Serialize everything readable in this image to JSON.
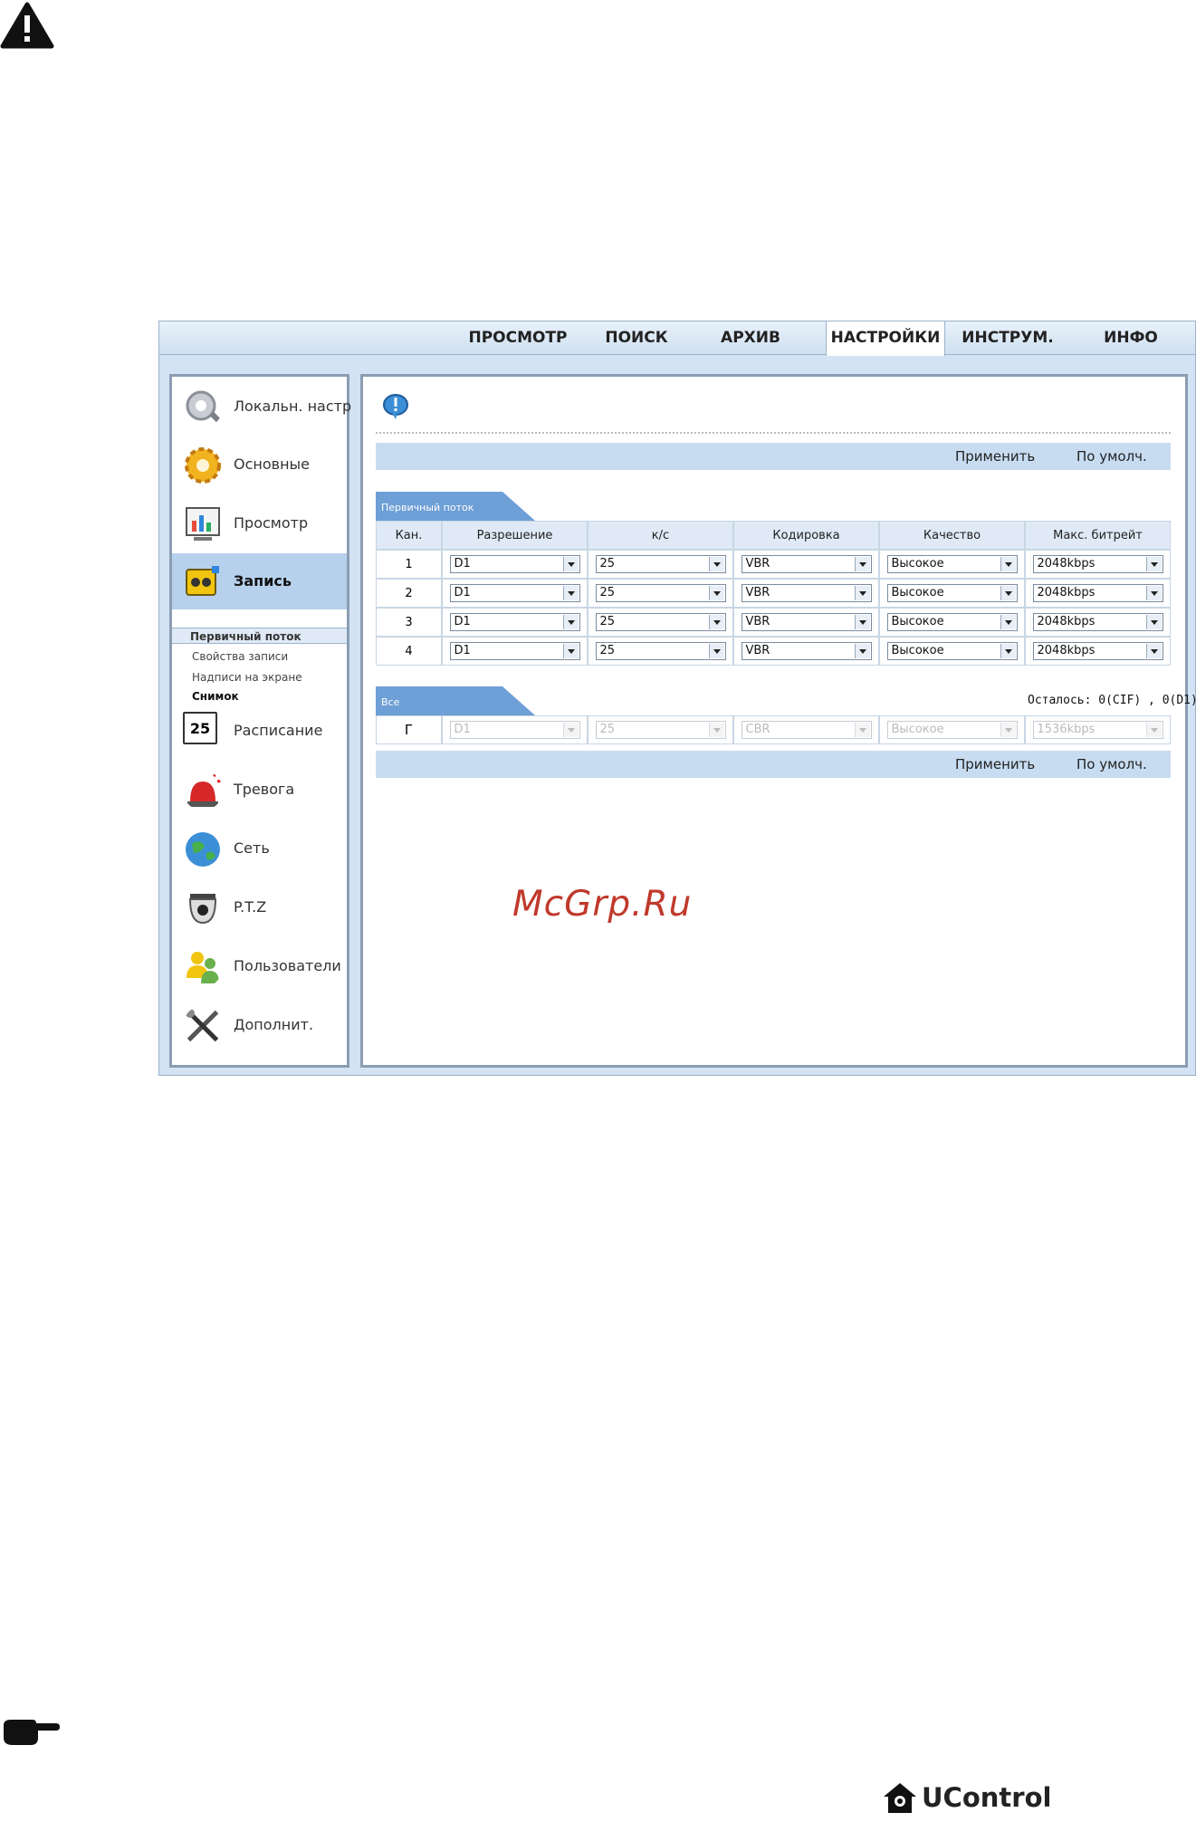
{
  "tabs": [
    "ПРОСМОТР",
    "ПОИСК",
    "АРХИВ",
    "НАСТРОЙКИ",
    "ИНСТРУМ.",
    "ИНФО"
  ],
  "active_tab": "НАСТРОЙКИ",
  "sidebar": {
    "items": [
      "Локальн. настр",
      "Основные",
      "Просмотр",
      "Запись",
      "Расписание",
      "Тревога",
      "Сеть",
      "P.T.Z",
      "Пользователи",
      "Дополнит."
    ],
    "active_item": "Запись",
    "calendar_day": "25",
    "sub_items": [
      "Первичный поток",
      "Свойства записи",
      "Надписи на экране",
      "Снимок"
    ]
  },
  "toolbar": {
    "apply": "Применить",
    "default": "По умолч."
  },
  "primary_stream": {
    "title": "Первичный поток",
    "headers": [
      "Кан.",
      "Разрешение",
      "к/с",
      "Кодировка",
      "Качество",
      "Макс. битрейт"
    ],
    "rows": [
      {
        "ch": "1",
        "res": "D1",
        "fps": "25",
        "enc": "VBR",
        "quality": "Высокое",
        "bitrate": "2048kbps"
      },
      {
        "ch": "2",
        "res": "D1",
        "fps": "25",
        "enc": "VBR",
        "quality": "Высокое",
        "bitrate": "2048kbps"
      },
      {
        "ch": "3",
        "res": "D1",
        "fps": "25",
        "enc": "VBR",
        "quality": "Высокое",
        "bitrate": "2048kbps"
      },
      {
        "ch": "4",
        "res": "D1",
        "fps": "25",
        "enc": "VBR",
        "quality": "Высокое",
        "bitrate": "2048kbps"
      }
    ]
  },
  "all_section": {
    "title": "Все",
    "remaining": "Осталось: 0(CIF) , 0(D1).",
    "checkbox": "Г",
    "values": {
      "res": "D1",
      "fps": "25",
      "enc": "CBR",
      "quality": "Высокое",
      "bitrate": "1536kbps"
    }
  },
  "watermark": "McGrp.Ru",
  "logo": "UControl",
  "colors": {
    "accent": "#b7d1ec",
    "bar": "#c7dcf1",
    "border": "#8a9db3",
    "watermark": "#c0392b"
  }
}
